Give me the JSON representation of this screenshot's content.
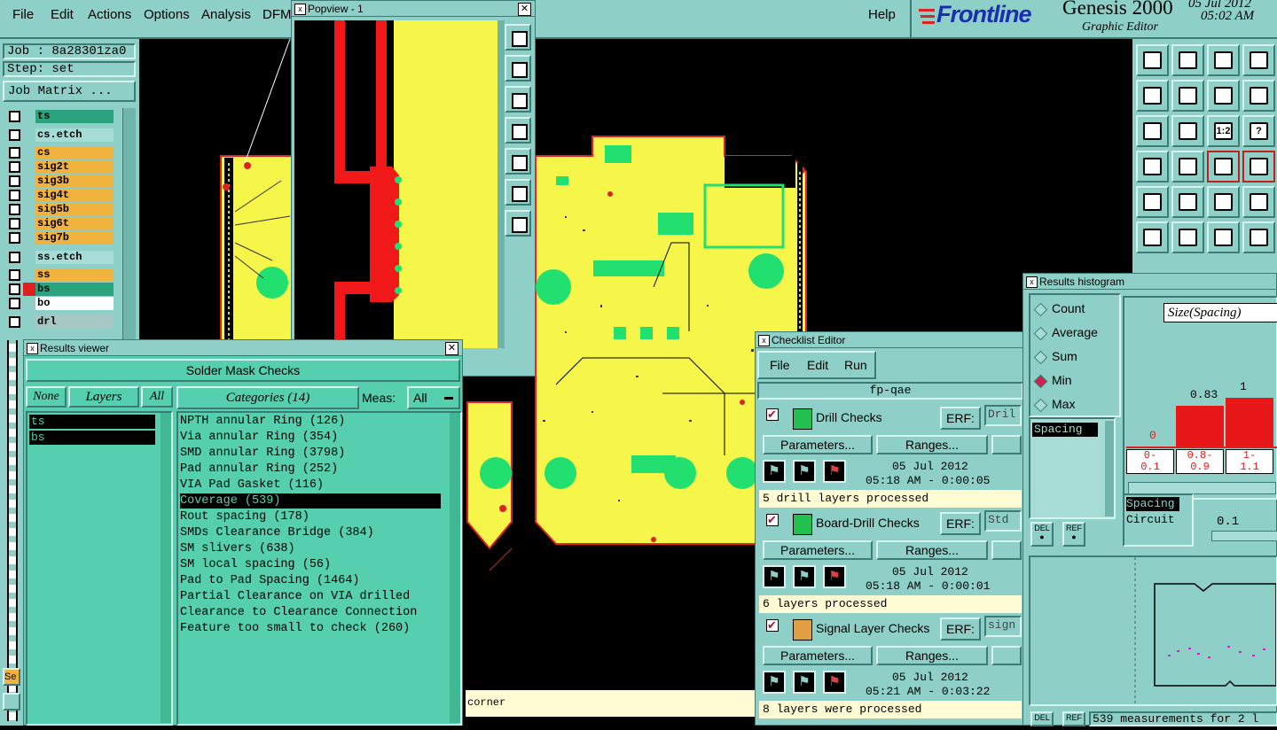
{
  "menubar": {
    "items": [
      "File",
      "Edit",
      "Actions",
      "Options",
      "Analysis",
      "DFM"
    ],
    "help": "Help",
    "brand": "Frontline",
    "product": "Genesis 2000",
    "subtitle": "Graphic Editor",
    "date": "05 Jul 2012",
    "time": "05:02 AM"
  },
  "job": {
    "job_label": "Job : 8a28301za0",
    "step_label": "Step: set",
    "matrix_button": "Job Matrix ..."
  },
  "layers": [
    {
      "name": "ts",
      "color": "#2aa37e"
    },
    {
      "name": "cs.etch",
      "color": "#a6dcd5"
    },
    {
      "name": "cs",
      "color": "#f2b23e"
    },
    {
      "name": "sig2t",
      "color": "#f2b23e"
    },
    {
      "name": "sig3b",
      "color": "#f2b23e"
    },
    {
      "name": "sig4t",
      "color": "#f2b23e"
    },
    {
      "name": "sig5b",
      "color": "#f2b23e"
    },
    {
      "name": "sig6t",
      "color": "#f2b23e"
    },
    {
      "name": "sig7b",
      "color": "#f2b23e"
    },
    {
      "name": "ss.etch",
      "color": "#a6dcd5"
    },
    {
      "name": "ss",
      "color": "#f2b23e"
    },
    {
      "name": "bs",
      "color": "#2aa37e"
    },
    {
      "name": "bo",
      "color": "#ffffff"
    },
    {
      "name": "drl",
      "color": "#a6c8c4"
    }
  ],
  "popview": {
    "title": "Popview - 1"
  },
  "results_viewer": {
    "title": "Results viewer",
    "header": "Solder Mask Checks",
    "none_btn": "None",
    "layers_btn": "Layers",
    "all_btn": "All",
    "layer_items": [
      "ts",
      "bs"
    ],
    "categories_btn": "Categories (14)",
    "meas_label": "Meas:",
    "meas_value": "All",
    "categories": [
      "NPTH annular Ring (126)",
      "Via annular Ring (354)",
      "SMD annular Ring (3798)",
      "Pad annular Ring (252)",
      "VIA Pad Gasket (116)",
      "Coverage (539)",
      "Rout spacing (178)",
      "SMDs Clearance Bridge (384)",
      "SM slivers (638)",
      "SM local spacing (56)",
      "Pad to Pad Spacing (1464)",
      "Partial Clearance on VIA drilled",
      "Clearance to Clearance Connection",
      "Feature too small to check (260)"
    ],
    "selected_index": 5
  },
  "status": {
    "corner_text": "corner"
  },
  "checklist": {
    "title": "Checklist Editor",
    "menu": [
      "File",
      "Edit",
      "Run"
    ],
    "name": "fp-qae",
    "erf_label": "ERF:",
    "params_label": "Parameters...",
    "ranges_label": "Ranges...",
    "checks": [
      {
        "name": "Drill Checks",
        "erf": "Dril",
        "date": "05 Jul 2012",
        "time": "05:18 AM - 0:00:05",
        "status": "5 drill layers processed"
      },
      {
        "name": "Board-Drill Checks",
        "erf": "Std",
        "date": "05 Jul 2012",
        "time": "05:18 AM - 0:00:01",
        "status": "6 layers processed"
      },
      {
        "name": "Signal Layer Checks",
        "erf": "sign",
        "date": "05 Jul 2012",
        "time": "05:21 AM - 0:03:22",
        "status": "8 layers were processed"
      }
    ]
  },
  "histogram": {
    "title": "Results histogram",
    "options": [
      "Count",
      "Average",
      "Sum",
      "Min",
      "Max"
    ],
    "selected": "Min",
    "list_item": "Spacing",
    "size_label": "Size(Spacing)",
    "bars": [
      {
        "label": "0",
        "value": 0,
        "range": "0-\n0.1"
      },
      {
        "label": "0.83",
        "value": 0.83,
        "range": "0.8-\n0.9"
      },
      {
        "label": "1",
        "value": 1,
        "range": "1-\n1.1"
      }
    ],
    "detail_items": [
      "Spacing",
      "Circuit"
    ],
    "detail_value": "0.1",
    "del_label": "DEL",
    "ref_label": "REF",
    "footer": "539 measurements for 2 l"
  }
}
